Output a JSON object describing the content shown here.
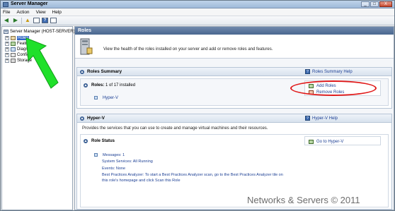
{
  "window": {
    "title": "Server Manager",
    "min": "_",
    "max": "□",
    "close": "X"
  },
  "menu": [
    "File",
    "Action",
    "View",
    "Help"
  ],
  "toolbar": {
    "help_glyph": "?"
  },
  "tree": {
    "root": "Server Manager (HOST-SERVER)",
    "items": [
      {
        "label": "Roles",
        "selected": true
      },
      {
        "label": "Features"
      },
      {
        "label": "Diagnostics"
      },
      {
        "label": "Configuration"
      },
      {
        "label": "Storage"
      }
    ]
  },
  "content": {
    "header": "Roles",
    "intro": "View the health of the roles installed on your server and add or remove roles and features.",
    "roles_summary": {
      "title": "Roles Summary",
      "help": "Roles Summary Help",
      "roles_label": "Roles:",
      "roles_value": "1 of 17 installed",
      "role_item": "Hyper-V",
      "add_roles": "Add Roles",
      "remove_roles": "Remove Roles"
    },
    "hyperv": {
      "title": "Hyper-V",
      "help": "Hyper-V Help",
      "description": "Provides the services that you can use to create and manage virtual machines and their resources.",
      "role_status_title": "Role Status",
      "go_to": "Go to Hyper-V",
      "messages": "Messages: 1",
      "system_services": "System Services: All Running",
      "events": "Events: None",
      "bpa_line1": "Best Practices Analyzer: To start a Best Practices Analyzer scan, go to the Best Practices Analyzer tile on",
      "bpa_line2": "this role's homepage and click Scan this Role"
    }
  },
  "watermark": "Networks & Servers © 2011",
  "colors": {
    "annotation_arrow": "#1fe02a",
    "annotation_ellipse": "#e01a1a",
    "header_blue": "#4a678f"
  }
}
